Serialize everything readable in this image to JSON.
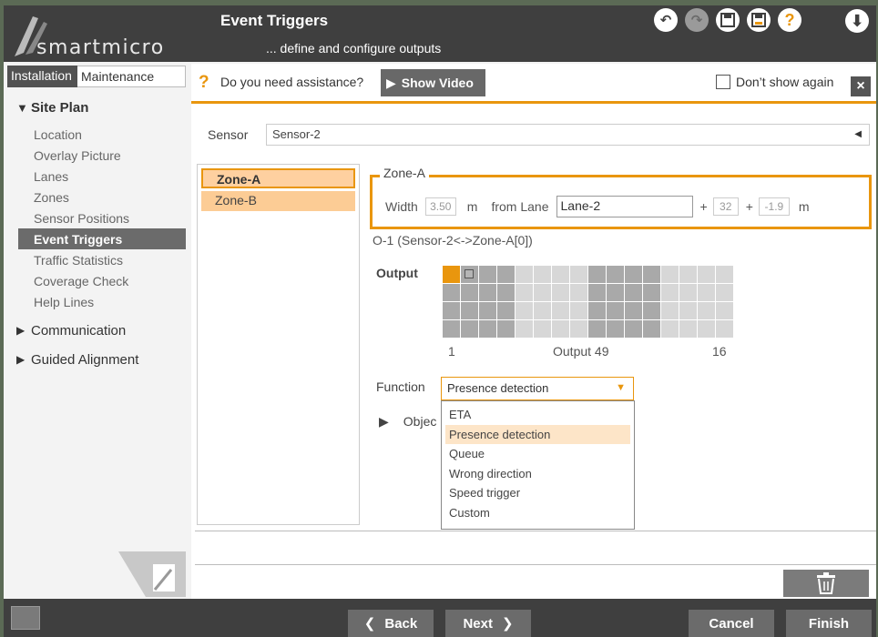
{
  "header": {
    "logo_text": "smartmicro",
    "title": "Event Triggers",
    "subtitle": "... define and configure outputs",
    "toolbar_icons": [
      "undo-icon",
      "redo-icon",
      "save-icon",
      "save-as-icon",
      "help-icon",
      "download-icon"
    ]
  },
  "tabs": {
    "installation": "Installation",
    "maintenance": "Maintenance"
  },
  "nav": {
    "site_plan": "Site Plan",
    "items": [
      "Location",
      "Overlay Picture",
      "Lanes",
      "Zones",
      "Sensor Positions",
      "Event Triggers",
      "Traffic Statistics",
      "Coverage Check",
      "Help Lines"
    ],
    "communication": "Communication",
    "guided_alignment": "Guided Alignment"
  },
  "assist": {
    "question_mark": "?",
    "text": "Do you need assistance?",
    "show_video": "Show Video",
    "dont_show": "Don’t show again",
    "close": "×"
  },
  "sensor": {
    "label": "Sensor",
    "value": "Sensor-2"
  },
  "zones": {
    "items": [
      "Zone-A",
      "Zone-B"
    ]
  },
  "zone_detail": {
    "title": "Zone-A",
    "width_label": "Width",
    "width_value": "3.50",
    "unit_m": "m",
    "from_lane_label": "from Lane",
    "lane_value": "Lane-2",
    "plus": "+",
    "offset1": "32",
    "offset2": "-1.9"
  },
  "output": {
    "id": "O-1 (Sensor-2<->Zone-A[0])",
    "label": "Output",
    "first_label": "1",
    "current_label": "Output 49",
    "last_label": "16",
    "colors": {
      "selected": "#e9960e",
      "dark": "#a9a9a9",
      "light": "#d7d7d7",
      "marked": "#b5b5b5"
    }
  },
  "function": {
    "label": "Function",
    "value": "Presence detection",
    "options": [
      "ETA",
      "Presence detection",
      "Queue",
      "Wrong direction",
      "Speed trigger",
      "Custom"
    ]
  },
  "object_label": "Objec",
  "footer": {
    "back": "Back",
    "next": "Next",
    "cancel": "Cancel",
    "finish": "Finish"
  },
  "accent_color": "#e9960e"
}
